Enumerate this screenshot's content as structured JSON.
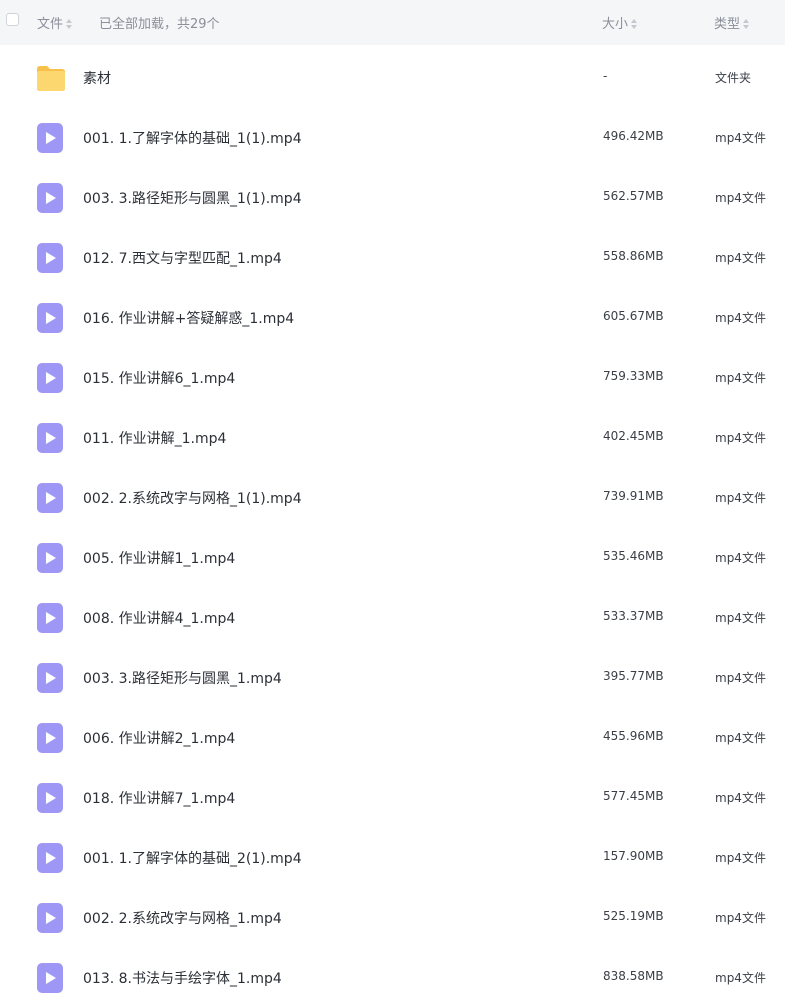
{
  "header": {
    "name_label": "文件",
    "loaded_status": "已全部加载，共29个",
    "size_label": "大小",
    "type_label": "类型"
  },
  "colors": {
    "folder": "#fbcf5e",
    "video": "#9e97f5",
    "header_bg": "#f5f6f8"
  },
  "files": [
    {
      "icon": "folder-icon",
      "name": "素材",
      "size": "-",
      "type": "文件夹"
    },
    {
      "icon": "video-file-icon",
      "name": "001. 1.了解字体的基础_1(1).mp4",
      "size": "496.42MB",
      "type": "mp4文件"
    },
    {
      "icon": "video-file-icon",
      "name": "003. 3.路径矩形与圆黑_1(1).mp4",
      "size": "562.57MB",
      "type": "mp4文件"
    },
    {
      "icon": "video-file-icon",
      "name": "012. 7.西文与字型匹配_1.mp4",
      "size": "558.86MB",
      "type": "mp4文件"
    },
    {
      "icon": "video-file-icon",
      "name": "016. 作业讲解+答疑解惑_1.mp4",
      "size": "605.67MB",
      "type": "mp4文件"
    },
    {
      "icon": "video-file-icon",
      "name": "015. 作业讲解6_1.mp4",
      "size": "759.33MB",
      "type": "mp4文件"
    },
    {
      "icon": "video-file-icon",
      "name": "011. 作业讲解_1.mp4",
      "size": "402.45MB",
      "type": "mp4文件"
    },
    {
      "icon": "video-file-icon",
      "name": "002. 2.系统改字与网格_1(1).mp4",
      "size": "739.91MB",
      "type": "mp4文件"
    },
    {
      "icon": "video-file-icon",
      "name": "005. 作业讲解1_1.mp4",
      "size": "535.46MB",
      "type": "mp4文件"
    },
    {
      "icon": "video-file-icon",
      "name": "008. 作业讲解4_1.mp4",
      "size": "533.37MB",
      "type": "mp4文件"
    },
    {
      "icon": "video-file-icon",
      "name": "003. 3.路径矩形与圆黑_1.mp4",
      "size": "395.77MB",
      "type": "mp4文件"
    },
    {
      "icon": "video-file-icon",
      "name": "006. 作业讲解2_1.mp4",
      "size": "455.96MB",
      "type": "mp4文件"
    },
    {
      "icon": "video-file-icon",
      "name": "018. 作业讲解7_1.mp4",
      "size": "577.45MB",
      "type": "mp4文件"
    },
    {
      "icon": "video-file-icon",
      "name": "001. 1.了解字体的基础_2(1).mp4",
      "size": "157.90MB",
      "type": "mp4文件"
    },
    {
      "icon": "video-file-icon",
      "name": "002. 2.系统改字与网格_1.mp4",
      "size": "525.19MB",
      "type": "mp4文件"
    },
    {
      "icon": "video-file-icon",
      "name": "013. 8.书法与手绘字体_1.mp4",
      "size": "838.58MB",
      "type": "mp4文件"
    }
  ]
}
